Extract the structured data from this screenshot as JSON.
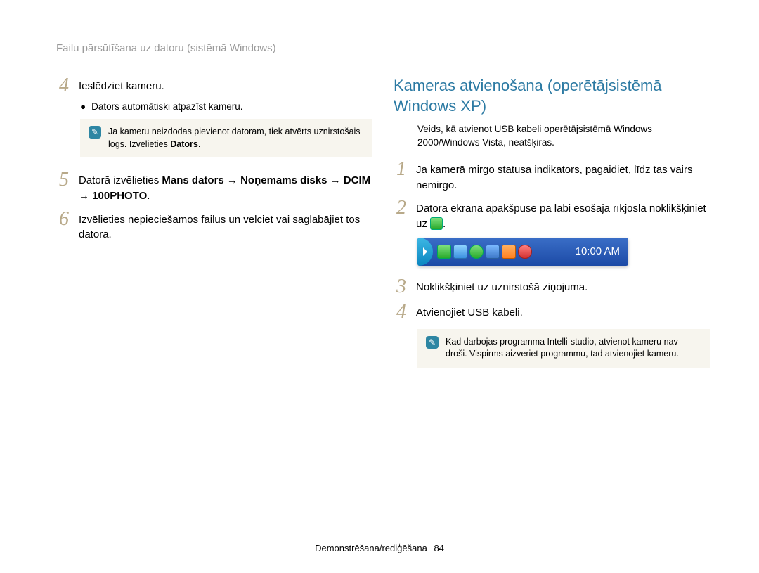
{
  "header": "Failu pārsūtīšana uz datoru (sistēmā Windows)",
  "left": {
    "step4": "Ieslēdziet kameru.",
    "step4_bullet": "Dators automātiski atpazīst kameru.",
    "note": {
      "text_a": "Ja kameru neizdodas pievienot datoram, tiek atvērts uznirstošais logs. Izvēlieties ",
      "text_b": "Dators",
      "text_c": "."
    },
    "step5_a": "Datorā izvēlieties ",
    "step5_b": "Mans dators → Noņemams disks → DCIM → 100PHOTO",
    "step5_c": ".",
    "step6": "Izvēlieties nepieciešamos failus un velciet vai saglabājiet tos datorā."
  },
  "right": {
    "title": "Kameras atvienošana (operētājsistēmā Windows XP)",
    "sub": "Veids, kā atvienot USB kabeli operētājsistēmā Windows 2000/Windows Vista, neatšķiras.",
    "step1": "Ja kamerā mirgo statusa indikators, pagaidiet, līdz tas vairs nemirgo.",
    "step2_a": "Datora ekrāna apakšpusē pa labi esošajā rīkjoslā noklikšķiniet uz ",
    "step2_b": ".",
    "tray_time": "10:00 AM",
    "step3": "Noklikšķiniet uz uznirstošā ziņojuma.",
    "step4": "Atvienojiet USB kabeli.",
    "note": "Kad darbojas programma Intelli-studio, atvienot kameru nav droši. Vispirms aizveriet programmu, tad atvienojiet kameru."
  },
  "footer": {
    "section": "Demonstrēšana/rediģēšana",
    "page": "84"
  }
}
